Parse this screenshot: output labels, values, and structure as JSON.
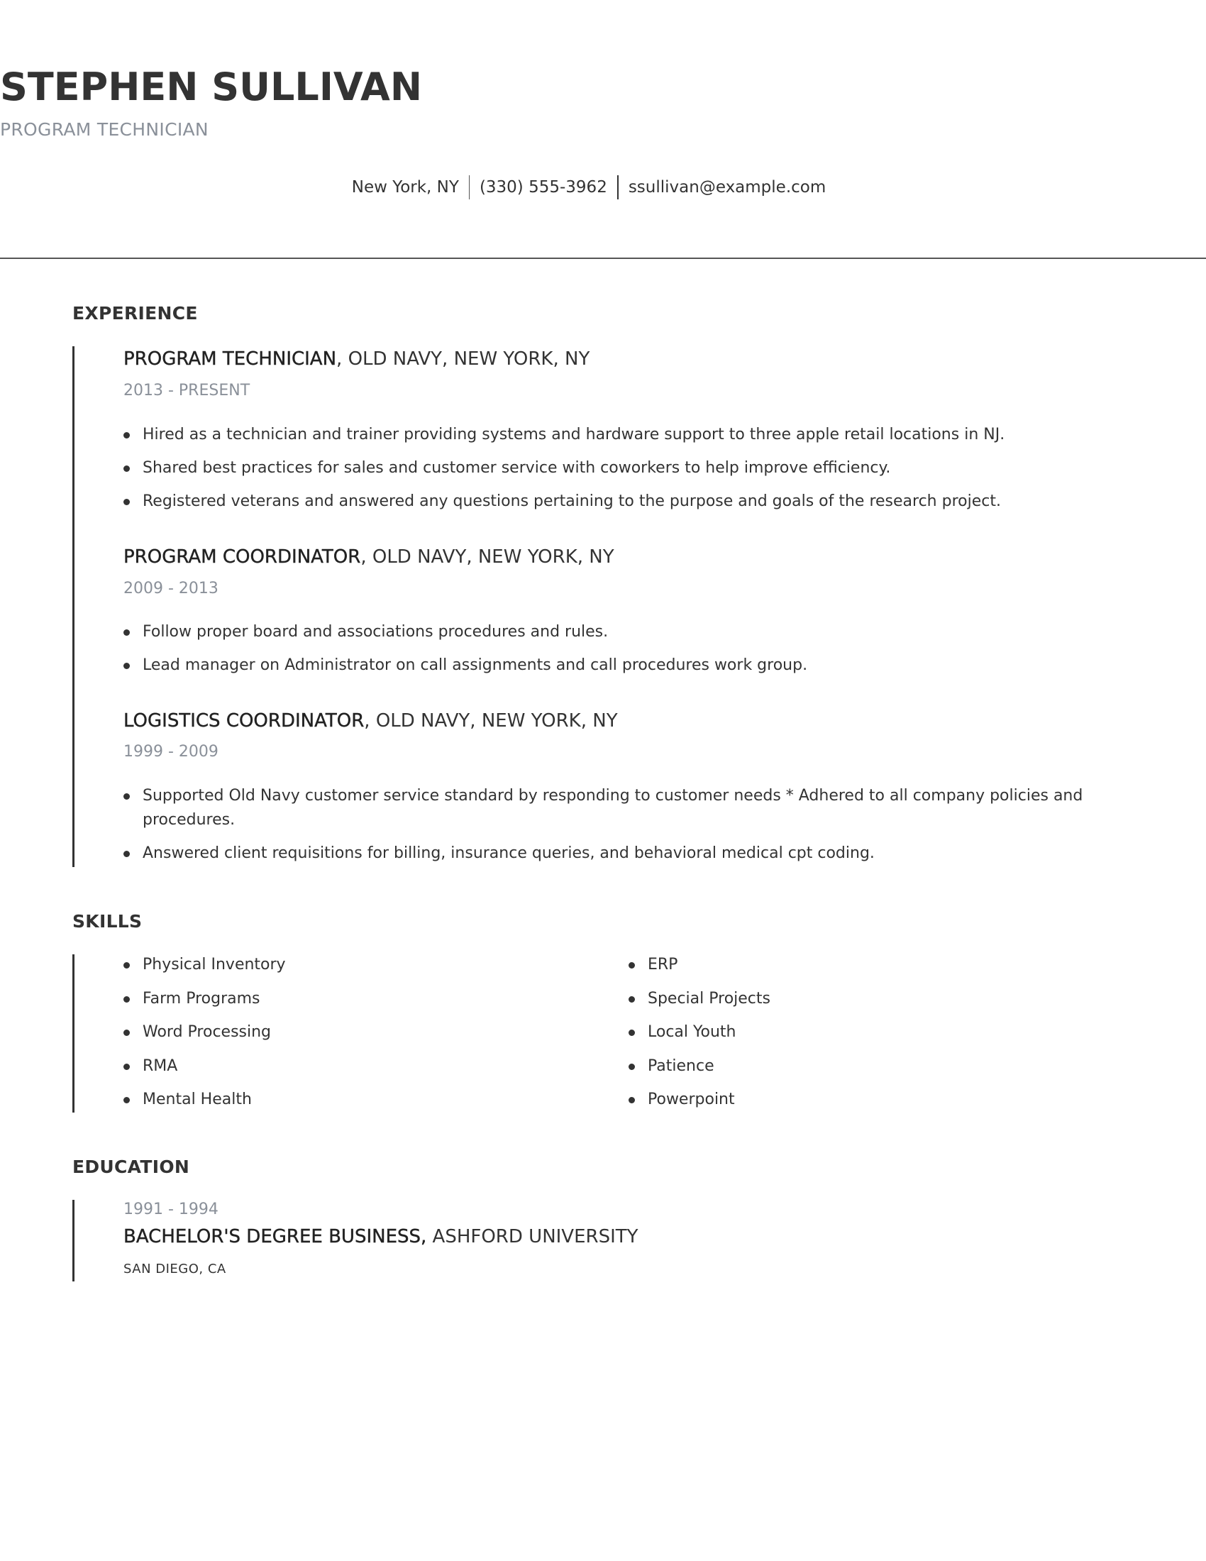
{
  "header": {
    "name": "STEPHEN SULLIVAN",
    "title": "PROGRAM TECHNICIAN",
    "contact": {
      "location": "New York, NY",
      "phone": "(330) 555-3962",
      "email": "ssullivan@example.com"
    }
  },
  "sections": {
    "experience_title": "EXPERIENCE",
    "skills_title": "SKILLS",
    "education_title": "EDUCATION"
  },
  "experience": [
    {
      "role": "PROGRAM TECHNICIAN",
      "company": ", OLD NAVY, NEW YORK, NY",
      "dates": "2013 - PRESENT",
      "bullets": [
        "Hired as a technician and trainer providing systems and hardware support to three apple retail locations in NJ.",
        "Shared best practices for sales and customer service with coworkers to help improve efficiency.",
        "Registered veterans and answered any questions pertaining to the purpose and goals of the research project."
      ]
    },
    {
      "role": "PROGRAM COORDINATOR",
      "company": ", OLD NAVY, NEW YORK, NY",
      "dates": "2009 - 2013",
      "bullets": [
        "Follow proper board and associations procedures and rules.",
        "Lead manager on Administrator on call assignments and call procedures work group."
      ]
    },
    {
      "role": "LOGISTICS COORDINATOR",
      "company": ", OLD NAVY, NEW YORK, NY",
      "dates": "1999 - 2009",
      "bullets": [
        "Supported Old Navy customer service standard by responding to customer needs * Adhered to all company policies and procedures.",
        "Answered client requisitions for billing, insurance queries, and behavioral medical cpt coding."
      ]
    }
  ],
  "skills": {
    "left": [
      "Physical Inventory",
      "Farm Programs",
      "Word Processing",
      "RMA",
      "Mental Health"
    ],
    "right": [
      "ERP",
      "Special Projects",
      "Local Youth",
      "Patience",
      "Powerpoint"
    ]
  },
  "education": {
    "dates": "1991 - 1994",
    "degree": "BACHELOR'S DEGREE BUSINESS,",
    "school": " ASHFORD UNIVERSITY",
    "location": "SAN DIEGO, CA"
  },
  "colors": {
    "text": "#333333",
    "muted": "#8a9099",
    "rule": "#555555"
  }
}
